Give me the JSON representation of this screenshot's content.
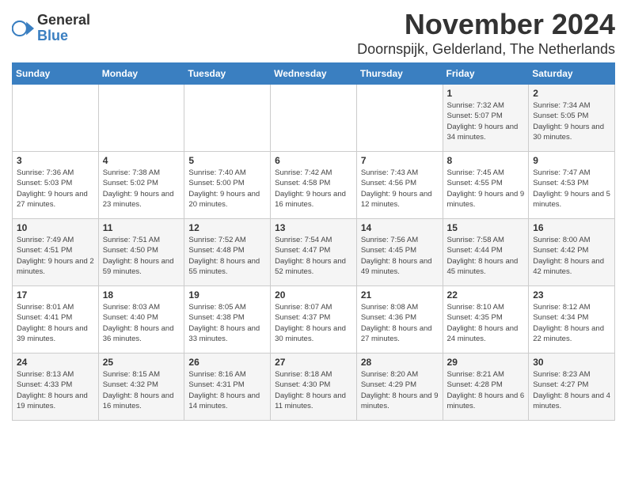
{
  "logo": {
    "general": "General",
    "blue": "Blue"
  },
  "title": {
    "month": "November 2024",
    "location": "Doornspijk, Gelderland, The Netherlands"
  },
  "headers": [
    "Sunday",
    "Monday",
    "Tuesday",
    "Wednesday",
    "Thursday",
    "Friday",
    "Saturday"
  ],
  "weeks": [
    [
      {
        "day": "",
        "info": ""
      },
      {
        "day": "",
        "info": ""
      },
      {
        "day": "",
        "info": ""
      },
      {
        "day": "",
        "info": ""
      },
      {
        "day": "",
        "info": ""
      },
      {
        "day": "1",
        "info": "Sunrise: 7:32 AM\nSunset: 5:07 PM\nDaylight: 9 hours and 34 minutes."
      },
      {
        "day": "2",
        "info": "Sunrise: 7:34 AM\nSunset: 5:05 PM\nDaylight: 9 hours and 30 minutes."
      }
    ],
    [
      {
        "day": "3",
        "info": "Sunrise: 7:36 AM\nSunset: 5:03 PM\nDaylight: 9 hours and 27 minutes."
      },
      {
        "day": "4",
        "info": "Sunrise: 7:38 AM\nSunset: 5:02 PM\nDaylight: 9 hours and 23 minutes."
      },
      {
        "day": "5",
        "info": "Sunrise: 7:40 AM\nSunset: 5:00 PM\nDaylight: 9 hours and 20 minutes."
      },
      {
        "day": "6",
        "info": "Sunrise: 7:42 AM\nSunset: 4:58 PM\nDaylight: 9 hours and 16 minutes."
      },
      {
        "day": "7",
        "info": "Sunrise: 7:43 AM\nSunset: 4:56 PM\nDaylight: 9 hours and 12 minutes."
      },
      {
        "day": "8",
        "info": "Sunrise: 7:45 AM\nSunset: 4:55 PM\nDaylight: 9 hours and 9 minutes."
      },
      {
        "day": "9",
        "info": "Sunrise: 7:47 AM\nSunset: 4:53 PM\nDaylight: 9 hours and 5 minutes."
      }
    ],
    [
      {
        "day": "10",
        "info": "Sunrise: 7:49 AM\nSunset: 4:51 PM\nDaylight: 9 hours and 2 minutes."
      },
      {
        "day": "11",
        "info": "Sunrise: 7:51 AM\nSunset: 4:50 PM\nDaylight: 8 hours and 59 minutes."
      },
      {
        "day": "12",
        "info": "Sunrise: 7:52 AM\nSunset: 4:48 PM\nDaylight: 8 hours and 55 minutes."
      },
      {
        "day": "13",
        "info": "Sunrise: 7:54 AM\nSunset: 4:47 PM\nDaylight: 8 hours and 52 minutes."
      },
      {
        "day": "14",
        "info": "Sunrise: 7:56 AM\nSunset: 4:45 PM\nDaylight: 8 hours and 49 minutes."
      },
      {
        "day": "15",
        "info": "Sunrise: 7:58 AM\nSunset: 4:44 PM\nDaylight: 8 hours and 45 minutes."
      },
      {
        "day": "16",
        "info": "Sunrise: 8:00 AM\nSunset: 4:42 PM\nDaylight: 8 hours and 42 minutes."
      }
    ],
    [
      {
        "day": "17",
        "info": "Sunrise: 8:01 AM\nSunset: 4:41 PM\nDaylight: 8 hours and 39 minutes."
      },
      {
        "day": "18",
        "info": "Sunrise: 8:03 AM\nSunset: 4:40 PM\nDaylight: 8 hours and 36 minutes."
      },
      {
        "day": "19",
        "info": "Sunrise: 8:05 AM\nSunset: 4:38 PM\nDaylight: 8 hours and 33 minutes."
      },
      {
        "day": "20",
        "info": "Sunrise: 8:07 AM\nSunset: 4:37 PM\nDaylight: 8 hours and 30 minutes."
      },
      {
        "day": "21",
        "info": "Sunrise: 8:08 AM\nSunset: 4:36 PM\nDaylight: 8 hours and 27 minutes."
      },
      {
        "day": "22",
        "info": "Sunrise: 8:10 AM\nSunset: 4:35 PM\nDaylight: 8 hours and 24 minutes."
      },
      {
        "day": "23",
        "info": "Sunrise: 8:12 AM\nSunset: 4:34 PM\nDaylight: 8 hours and 22 minutes."
      }
    ],
    [
      {
        "day": "24",
        "info": "Sunrise: 8:13 AM\nSunset: 4:33 PM\nDaylight: 8 hours and 19 minutes."
      },
      {
        "day": "25",
        "info": "Sunrise: 8:15 AM\nSunset: 4:32 PM\nDaylight: 8 hours and 16 minutes."
      },
      {
        "day": "26",
        "info": "Sunrise: 8:16 AM\nSunset: 4:31 PM\nDaylight: 8 hours and 14 minutes."
      },
      {
        "day": "27",
        "info": "Sunrise: 8:18 AM\nSunset: 4:30 PM\nDaylight: 8 hours and 11 minutes."
      },
      {
        "day": "28",
        "info": "Sunrise: 8:20 AM\nSunset: 4:29 PM\nDaylight: 8 hours and 9 minutes."
      },
      {
        "day": "29",
        "info": "Sunrise: 8:21 AM\nSunset: 4:28 PM\nDaylight: 8 hours and 6 minutes."
      },
      {
        "day": "30",
        "info": "Sunrise: 8:23 AM\nSunset: 4:27 PM\nDaylight: 8 hours and 4 minutes."
      }
    ]
  ]
}
